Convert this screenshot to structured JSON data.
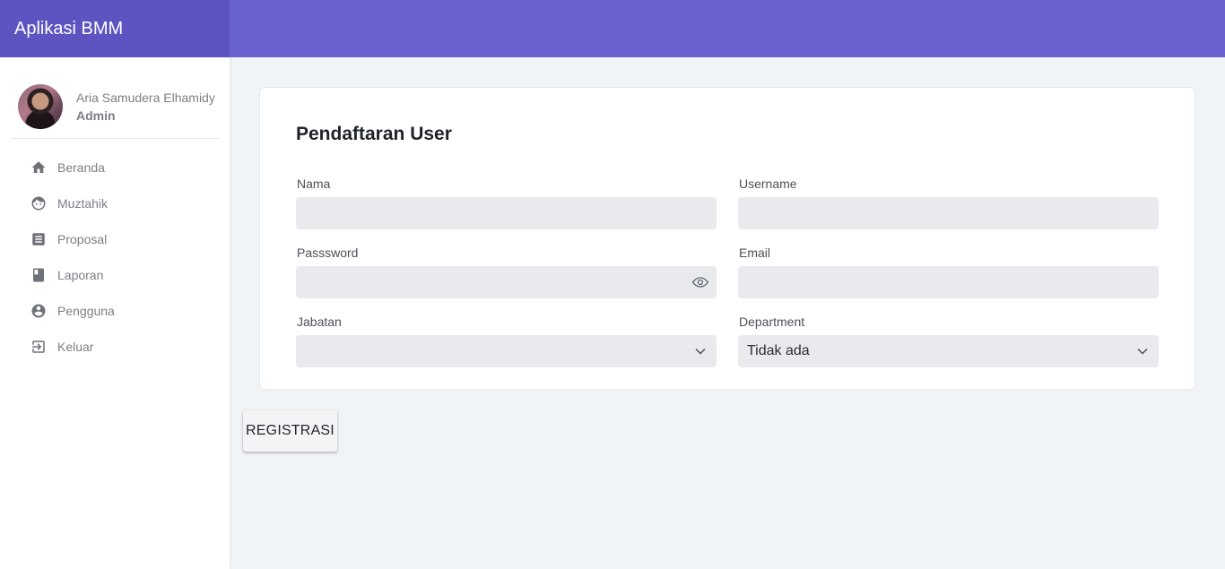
{
  "app": {
    "title": "Aplikasi BMM"
  },
  "colors": {
    "brand": "#5d54c2",
    "topbar": "#6a62cf",
    "background": "#f1f4f7"
  },
  "profile": {
    "name": "Aria Samudera Elhamidy",
    "role": "Admin"
  },
  "sidebar": {
    "items": [
      {
        "label": "Beranda",
        "icon": "home-icon"
      },
      {
        "label": "Muztahik",
        "icon": "face-icon"
      },
      {
        "label": "Proposal",
        "icon": "receipt-icon"
      },
      {
        "label": "Laporan",
        "icon": "book-icon"
      },
      {
        "label": "Pengguna",
        "icon": "account-circle-icon"
      },
      {
        "label": "Keluar",
        "icon": "logout-icon"
      }
    ]
  },
  "form": {
    "title": "Pendaftaran User",
    "nama": {
      "label": "Nama",
      "value": ""
    },
    "username": {
      "label": "Username",
      "value": ""
    },
    "password": {
      "label": "Passsword",
      "value": ""
    },
    "email": {
      "label": "Email",
      "value": ""
    },
    "jabatan": {
      "label": "Jabatan",
      "value": ""
    },
    "department": {
      "label": "Department",
      "value": "Tidak ada"
    }
  },
  "actions": {
    "register_label": "REGISTRASI"
  }
}
